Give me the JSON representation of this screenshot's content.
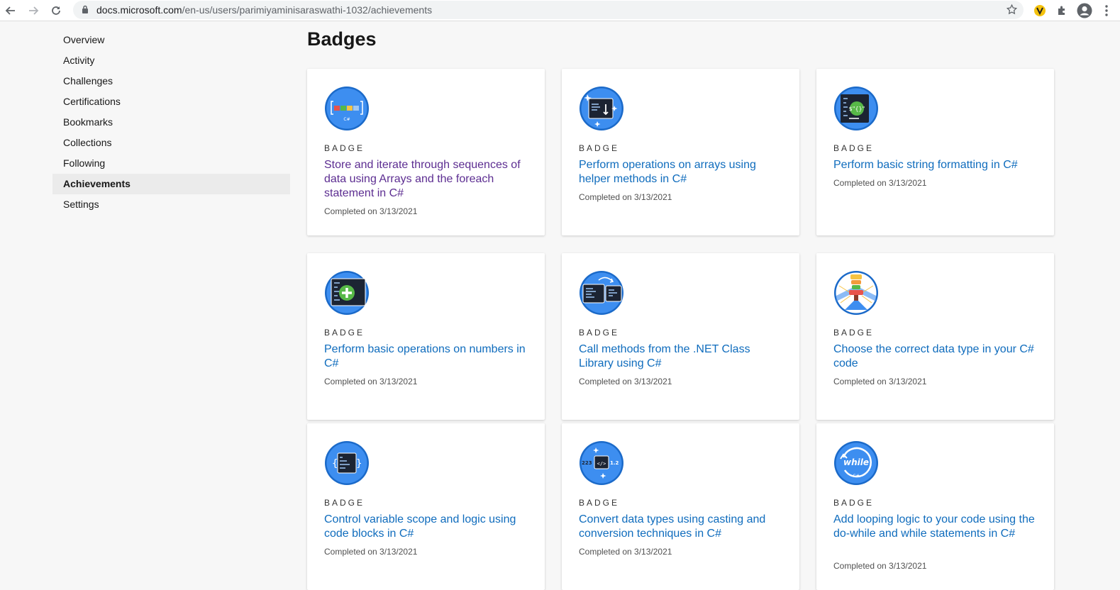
{
  "browser": {
    "url_host": "docs.microsoft.com",
    "url_path": "/en-us/users/parimiyaminisaraswathi-1032/achievements"
  },
  "sidebar": {
    "items": [
      {
        "label": "Overview"
      },
      {
        "label": "Activity"
      },
      {
        "label": "Challenges"
      },
      {
        "label": "Certifications"
      },
      {
        "label": "Bookmarks"
      },
      {
        "label": "Collections"
      },
      {
        "label": "Following"
      },
      {
        "label": "Achievements",
        "active": true
      },
      {
        "label": "Settings"
      }
    ]
  },
  "main": {
    "title": "Badges",
    "cards": [
      {
        "badge_label": "BADGE",
        "title": "Store and iterate through sequences of data using Arrays and the foreach statement in C#",
        "completed": "Completed on 3/13/2021",
        "icon": "arrays-badge-icon"
      },
      {
        "badge_label": "BADGE",
        "title": "Perform operations on arrays using helper methods in C#",
        "completed": "Completed on 3/13/2021",
        "icon": "array-helpers-badge-icon"
      },
      {
        "badge_label": "BADGE",
        "title": "Perform basic string formatting in C#",
        "completed": "Completed on 3/13/2021",
        "icon": "string-format-badge-icon"
      },
      {
        "badge_label": "BADGE",
        "title": "Perform basic operations on numbers in C#",
        "completed": "Completed on 3/13/2021",
        "icon": "numbers-badge-icon"
      },
      {
        "badge_label": "BADGE",
        "title": "Call methods from the .NET Class Library using C#",
        "completed": "Completed on 3/13/2021",
        "icon": "class-library-badge-icon"
      },
      {
        "badge_label": "BADGE",
        "title": "Choose the correct data type in your C# code",
        "completed": "Completed on 3/13/2021",
        "icon": "data-type-badge-icon"
      },
      {
        "badge_label": "BADGE",
        "title": "Control variable scope and logic using code blocks in C#",
        "completed": "Completed on 3/13/2021",
        "icon": "code-blocks-badge-icon"
      },
      {
        "badge_label": "BADGE",
        "title": "Convert data types using casting and conversion techniques in C#",
        "completed": "Completed on 3/13/2021",
        "icon": "casting-badge-icon",
        "badge_numbers": [
          "223",
          "1.2"
        ]
      },
      {
        "badge_label": "BADGE",
        "title": "Add looping logic to your code using the do-while and while statements in C#",
        "completed": "Completed on 3/13/2021",
        "icon": "while-loop-badge-icon",
        "badge_text": "while"
      }
    ]
  },
  "colors": {
    "link": "#0f6cbd",
    "visited": "#5c2d91",
    "badge_blue": "#3d8ef0"
  }
}
